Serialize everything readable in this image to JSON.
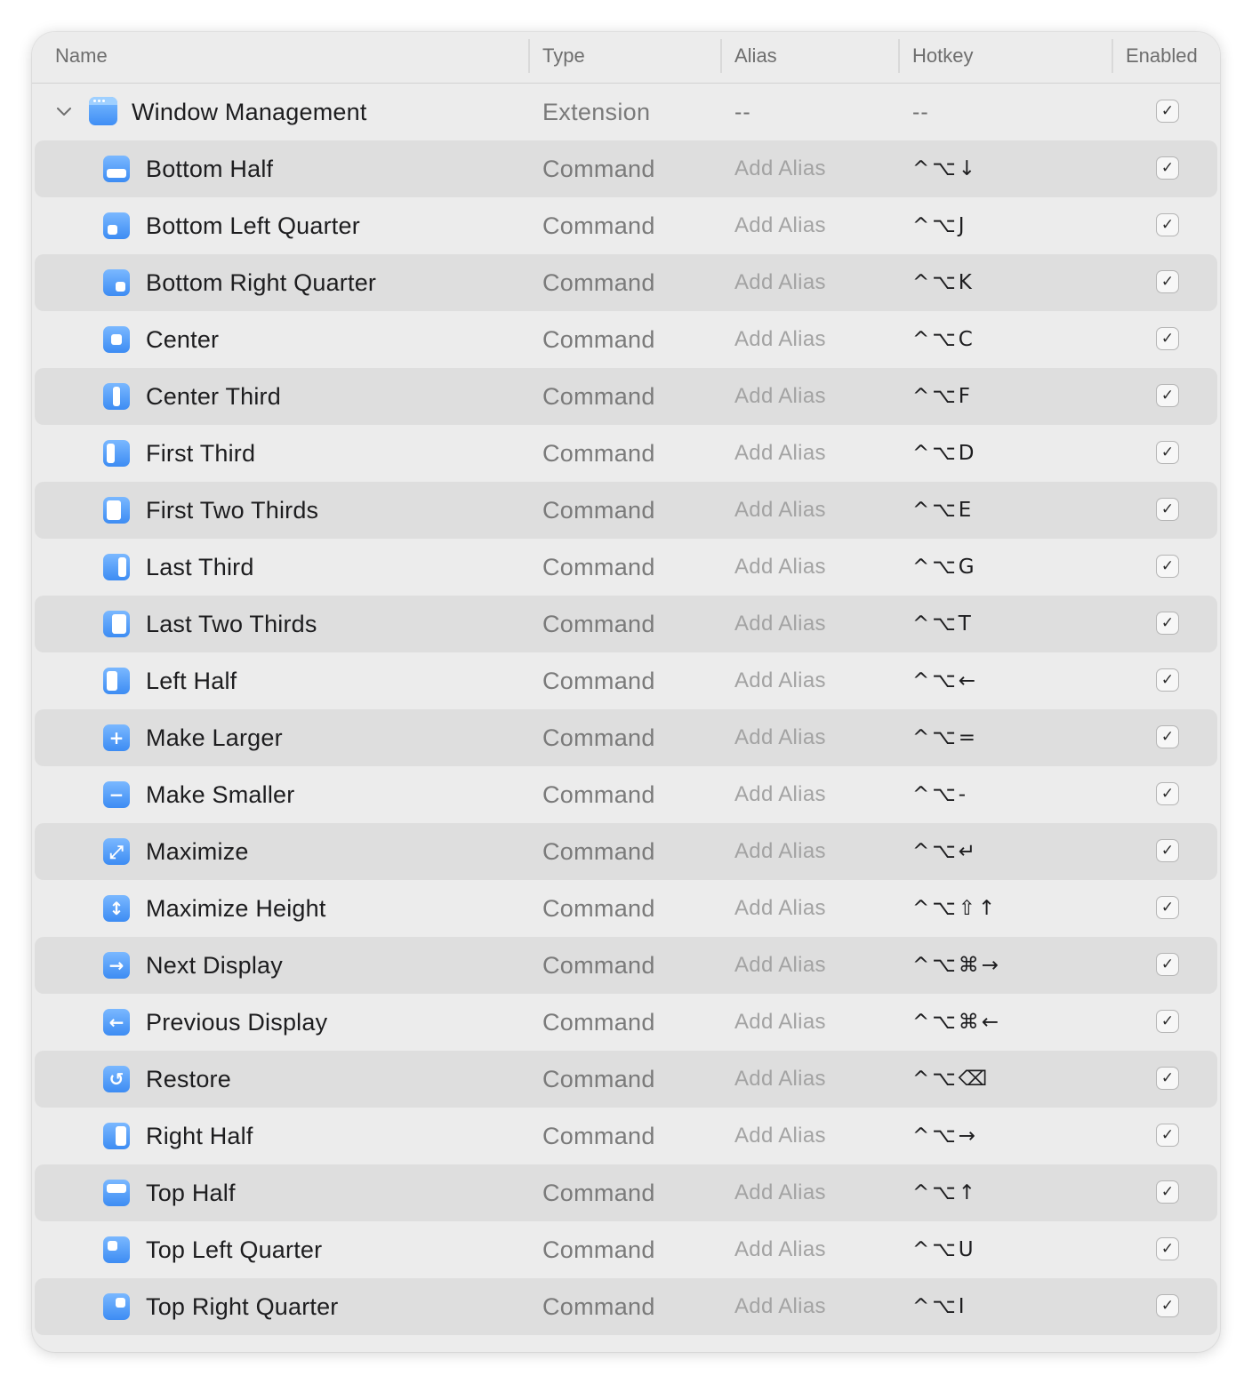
{
  "columns": {
    "name": "Name",
    "type": "Type",
    "alias": "Alias",
    "hotkey": "Hotkey",
    "enabled": "Enabled"
  },
  "group": {
    "name": "Window Management",
    "type": "Extension",
    "alias": "--",
    "hotkey": "--",
    "icon": "window-management-icon",
    "enabled": true
  },
  "commands": [
    {
      "name": "Bottom Half",
      "type": "Command",
      "alias": "Add Alias",
      "hotkey": "^⌥↓",
      "icon": "bottom-half-icon",
      "enabled": true
    },
    {
      "name": "Bottom Left Quarter",
      "type": "Command",
      "alias": "Add Alias",
      "hotkey": "^⌥J",
      "icon": "bottom-left-quarter-icon",
      "enabled": true
    },
    {
      "name": "Bottom Right Quarter",
      "type": "Command",
      "alias": "Add Alias",
      "hotkey": "^⌥K",
      "icon": "bottom-right-quarter-icon",
      "enabled": true
    },
    {
      "name": "Center",
      "type": "Command",
      "alias": "Add Alias",
      "hotkey": "^⌥C",
      "icon": "center-icon",
      "enabled": true
    },
    {
      "name": "Center Third",
      "type": "Command",
      "alias": "Add Alias",
      "hotkey": "^⌥F",
      "icon": "center-third-icon",
      "enabled": true
    },
    {
      "name": "First Third",
      "type": "Command",
      "alias": "Add Alias",
      "hotkey": "^⌥D",
      "icon": "first-third-icon",
      "enabled": true
    },
    {
      "name": "First Two Thirds",
      "type": "Command",
      "alias": "Add Alias",
      "hotkey": "^⌥E",
      "icon": "first-two-thirds-icon",
      "enabled": true
    },
    {
      "name": "Last Third",
      "type": "Command",
      "alias": "Add Alias",
      "hotkey": "^⌥G",
      "icon": "last-third-icon",
      "enabled": true
    },
    {
      "name": "Last Two Thirds",
      "type": "Command",
      "alias": "Add Alias",
      "hotkey": "^⌥T",
      "icon": "last-two-thirds-icon",
      "enabled": true
    },
    {
      "name": "Left Half",
      "type": "Command",
      "alias": "Add Alias",
      "hotkey": "^⌥←",
      "icon": "left-half-icon",
      "enabled": true
    },
    {
      "name": "Make Larger",
      "type": "Command",
      "alias": "Add Alias",
      "hotkey": "^⌥=",
      "icon": "make-larger-icon",
      "enabled": true
    },
    {
      "name": "Make Smaller",
      "type": "Command",
      "alias": "Add Alias",
      "hotkey": "^⌥-",
      "icon": "make-smaller-icon",
      "enabled": true
    },
    {
      "name": "Maximize",
      "type": "Command",
      "alias": "Add Alias",
      "hotkey": "^⌥↵",
      "icon": "maximize-icon",
      "enabled": true
    },
    {
      "name": "Maximize Height",
      "type": "Command",
      "alias": "Add Alias",
      "hotkey": "^⌥⇧↑",
      "icon": "maximize-height-icon",
      "enabled": true
    },
    {
      "name": "Next Display",
      "type": "Command",
      "alias": "Add Alias",
      "hotkey": "^⌥⌘→",
      "icon": "next-display-icon",
      "enabled": true
    },
    {
      "name": "Previous Display",
      "type": "Command",
      "alias": "Add Alias",
      "hotkey": "^⌥⌘←",
      "icon": "previous-display-icon",
      "enabled": true
    },
    {
      "name": "Restore",
      "type": "Command",
      "alias": "Add Alias",
      "hotkey": "^⌥⌫",
      "icon": "restore-icon",
      "enabled": true
    },
    {
      "name": "Right Half",
      "type": "Command",
      "alias": "Add Alias",
      "hotkey": "^⌥→",
      "icon": "right-half-icon",
      "enabled": true
    },
    {
      "name": "Top Half",
      "type": "Command",
      "alias": "Add Alias",
      "hotkey": "^⌥↑",
      "icon": "top-half-icon",
      "enabled": true
    },
    {
      "name": "Top Left Quarter",
      "type": "Command",
      "alias": "Add Alias",
      "hotkey": "^⌥U",
      "icon": "top-left-quarter-icon",
      "enabled": true
    },
    {
      "name": "Top Right Quarter",
      "type": "Command",
      "alias": "Add Alias",
      "hotkey": "^⌥I",
      "icon": "top-right-quarter-icon",
      "enabled": true
    }
  ],
  "colors": {
    "accent": "#3d8cf3",
    "panel": "#ececec",
    "alt_row": "#dedede"
  }
}
